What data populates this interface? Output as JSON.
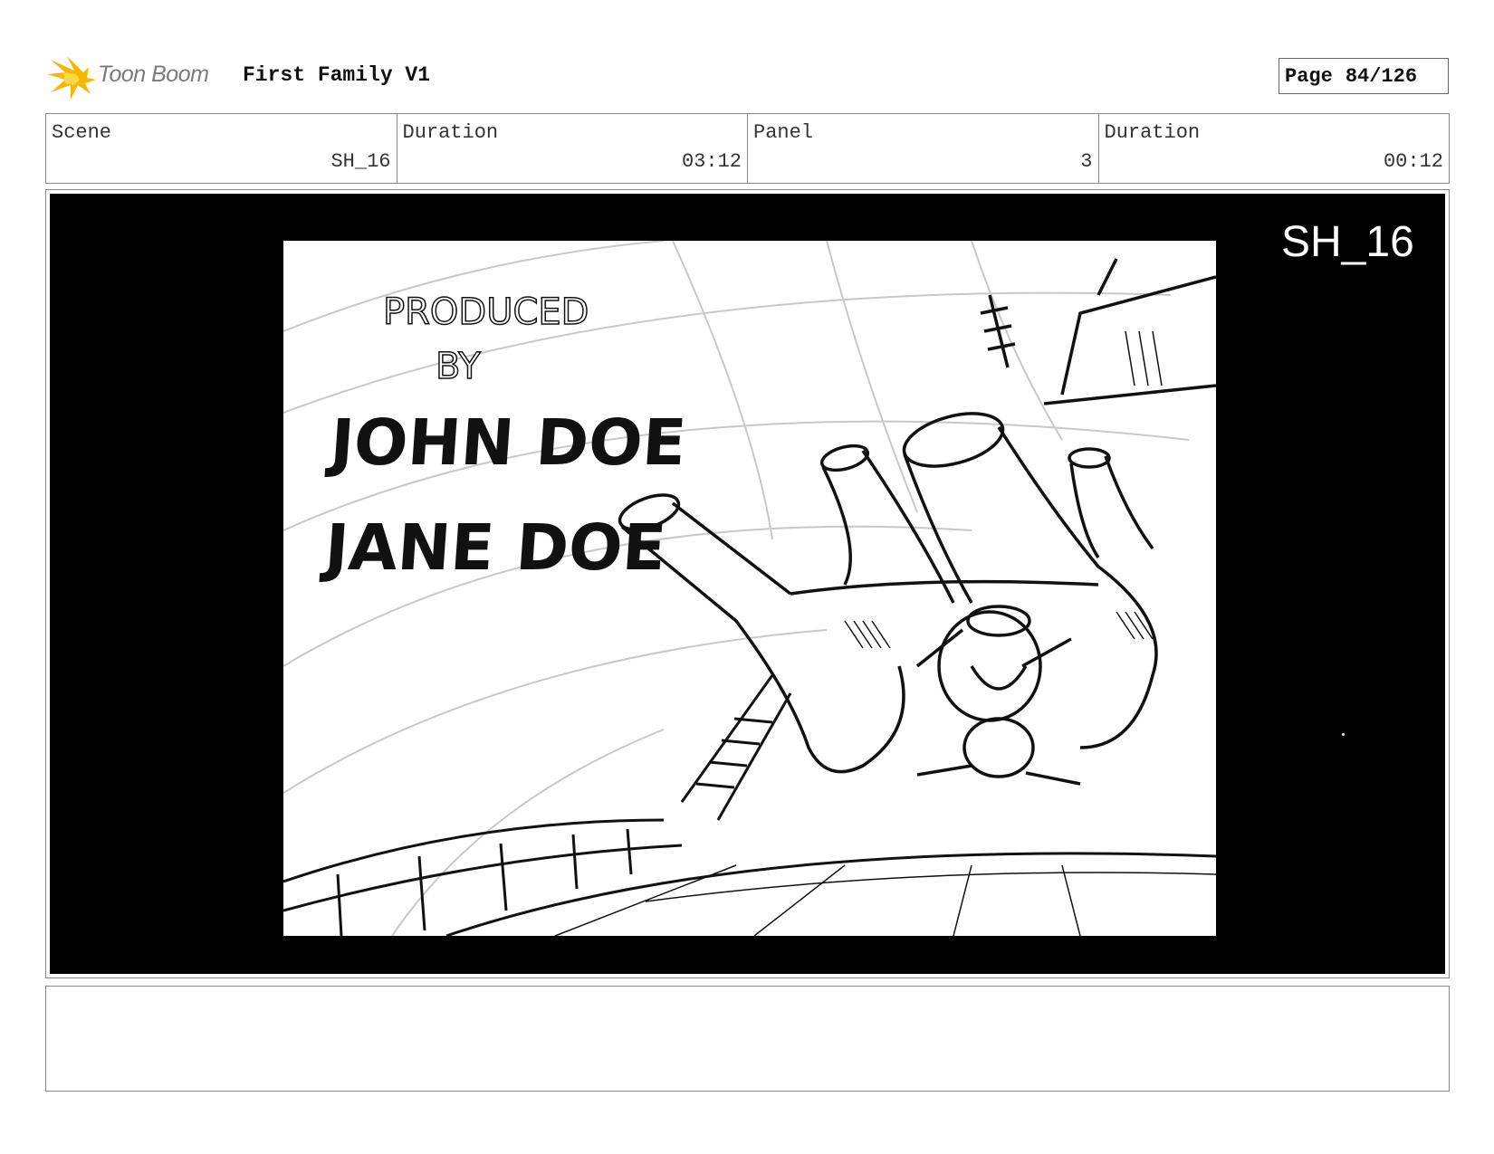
{
  "header": {
    "logo_text": "Toon Boom",
    "project_title": "First Family V1",
    "page_label": "Page",
    "page_number": "84/126"
  },
  "info": {
    "scene_label": "Scene",
    "scene_value": "SH_16",
    "duration_label": "Duration",
    "duration_value": "03:12",
    "panel_label": "Panel",
    "panel_value": "3",
    "panel_duration_label": "Duration",
    "panel_duration_value": "00:12"
  },
  "panel": {
    "shot_label": "SH_16",
    "credits": {
      "produced": "PRODUCED",
      "by": "BY",
      "name1": "JOHN DOE",
      "name2": "JANE DOE"
    }
  },
  "notes": {
    "text": ""
  },
  "colors": {
    "logo_yellow": "#f5b800",
    "logo_text": "#7a7a7a",
    "frame_border": "#888888",
    "panel_bg": "#000000"
  }
}
